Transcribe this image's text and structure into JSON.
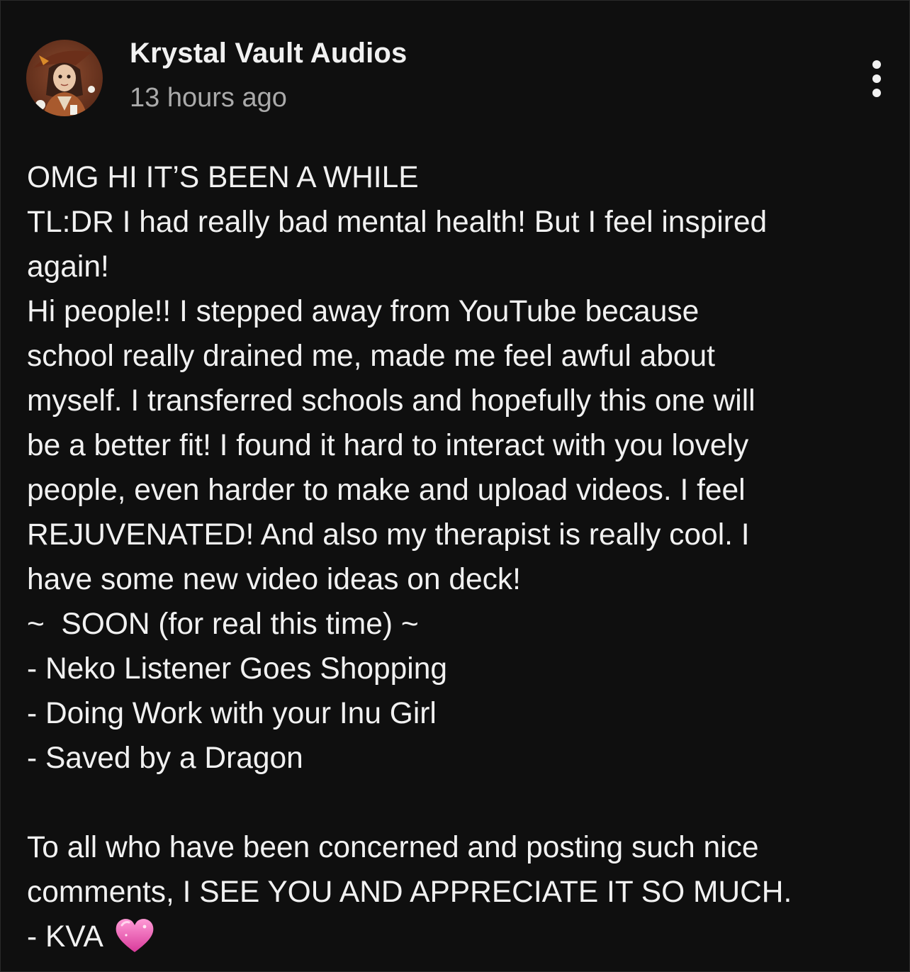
{
  "post": {
    "channel_name": "Krystal Vault Audios",
    "timestamp": "13 hours ago",
    "menu_icon": "more-vertical-icon",
    "avatar_icon": "channel-avatar",
    "lines": [
      "OMG HI IT’S BEEN A WHILE",
      "TL:DR I had really bad mental health! But I feel inspired",
      "again!",
      "Hi people!! I stepped away from YouTube because",
      "school really drained me, made me feel awful about",
      "myself. I transferred schools and hopefully this one will",
      "be a better fit! I found it hard to interact with you lovely",
      "people, even harder to make and upload videos. I feel",
      "REJUVENATED! And also my therapist is really cool. I",
      "have some new video ideas on deck!",
      "~  SOON (for real this time) ~",
      "- Neko Listener Goes Shopping",
      "- Doing Work with your Inu Girl",
      "- Saved by a Dragon",
      "",
      "To all who have been concerned and posting such nice",
      "comments, I SEE YOU AND APPRECIATE IT SO MUCH.",
      "- KVA"
    ],
    "signature_emoji": "sparkling-heart-icon",
    "colors": {
      "background": "#0f0f0f",
      "text": "#f1f1f1",
      "secondary_text": "#aaaaaa",
      "heart": "#f06ab8"
    }
  }
}
